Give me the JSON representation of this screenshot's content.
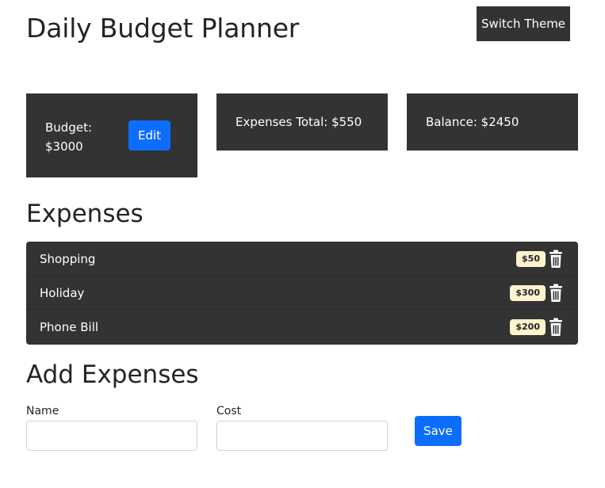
{
  "header": {
    "title": "Daily Budget Planner",
    "switch_theme_label": "Switch Theme"
  },
  "summary": {
    "budget_label": "Budget: $3000",
    "edit_label": "Edit",
    "expenses_total": "Expenses Total: $550",
    "balance": "Balance: $2450"
  },
  "expenses": {
    "title": "Expenses",
    "items": [
      {
        "name": "Shopping",
        "cost": "$50",
        "icon": "trash-icon"
      },
      {
        "name": "Holiday",
        "cost": "$300",
        "icon": "trash-icon"
      },
      {
        "name": "Phone Bill",
        "cost": "$200",
        "icon": "trash-icon"
      }
    ]
  },
  "add_expense": {
    "title": "Add Expenses",
    "name_label": "Name",
    "name_value": "",
    "cost_label": "Cost",
    "cost_value": "",
    "save_label": "Save"
  },
  "colors": {
    "card_bg": "#333333",
    "primary": "#0d6efd",
    "badge_bg": "#fff3cd"
  }
}
